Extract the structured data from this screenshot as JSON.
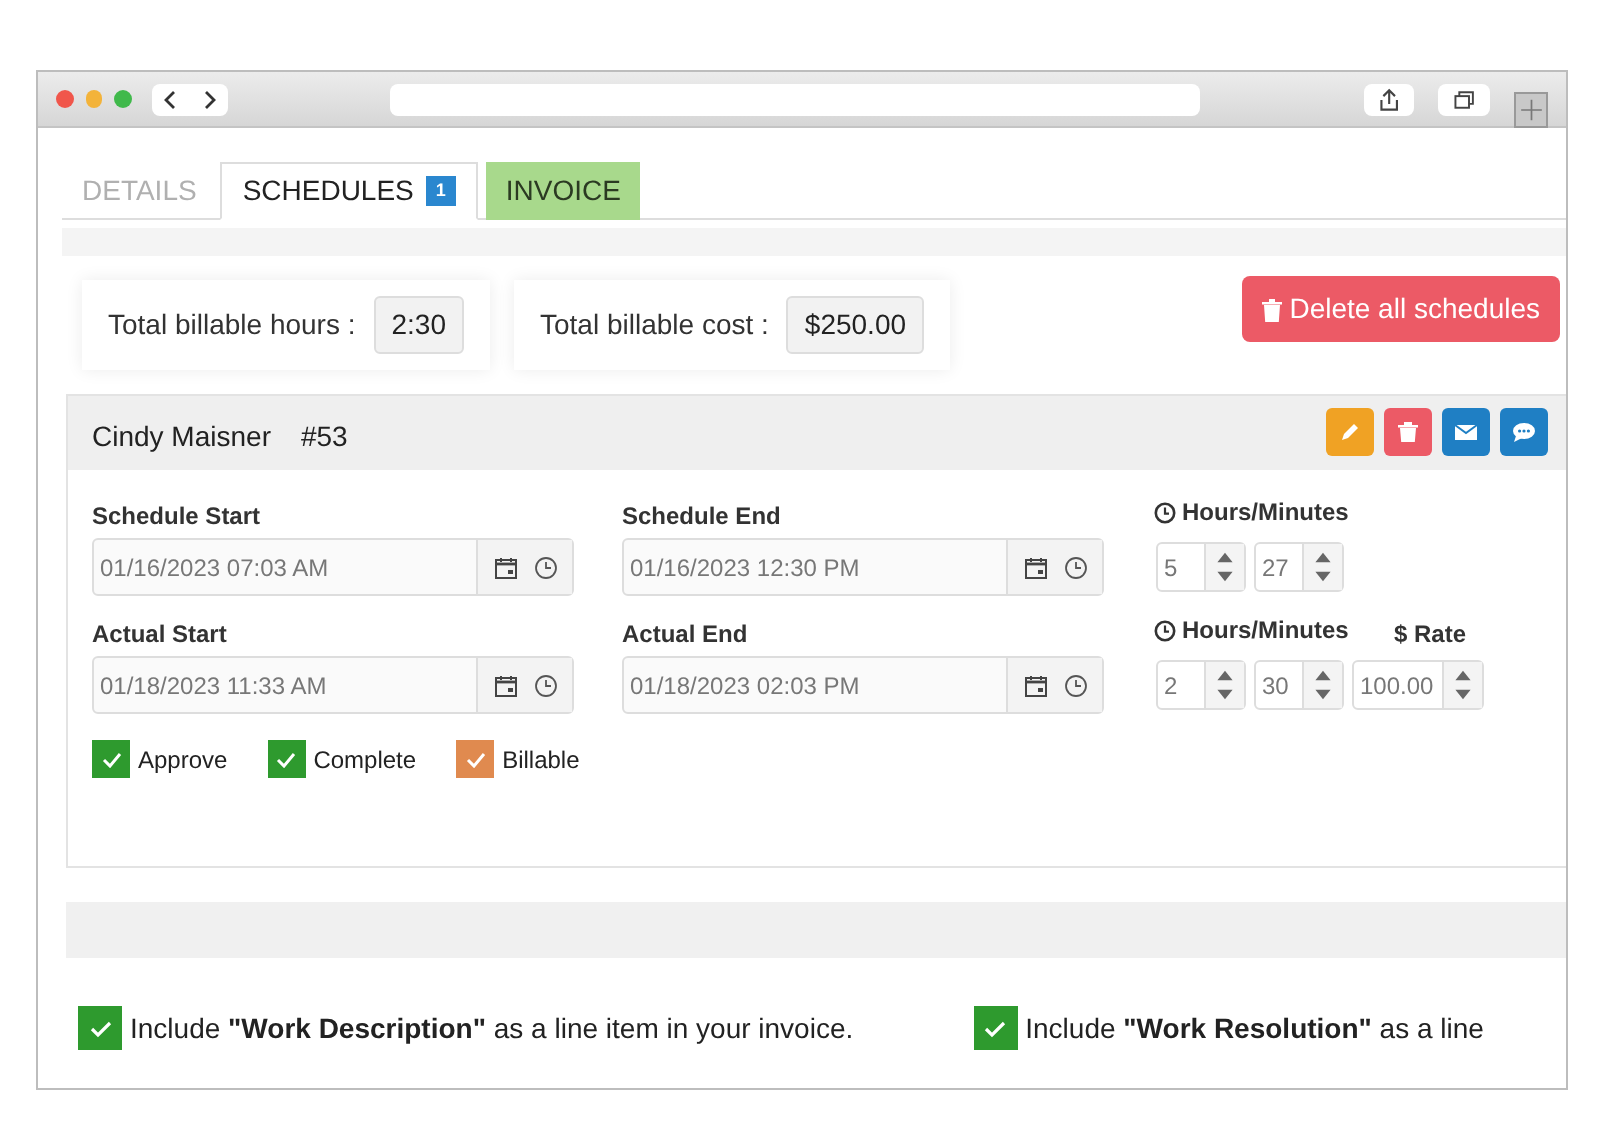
{
  "tabs": [
    {
      "label": "DETAILS",
      "selected": false,
      "kind": "plain"
    },
    {
      "label": "SCHEDULES",
      "selected": true,
      "kind": "plain",
      "badge": "1"
    },
    {
      "label": "INVOICE",
      "selected": false,
      "kind": "highlight"
    }
  ],
  "totals": [
    {
      "label": "Total billable hours :",
      "value": "2:30"
    },
    {
      "label": "Total billable cost :",
      "value": "$250.00"
    }
  ],
  "delete_all_button": {
    "label": "Delete all schedules"
  },
  "schedule": {
    "name": "Cindy Maisner",
    "number": "#53",
    "actions": [
      {
        "kind": "edit"
      },
      {
        "kind": "delete"
      },
      {
        "kind": "email"
      },
      {
        "kind": "comment"
      }
    ],
    "rows": [
      {
        "start_label": "Schedule Start",
        "start_value": "01/16/2023 07:03 AM",
        "end_label": "Schedule End",
        "end_value": "01/16/2023 12:30 PM",
        "duration_label": "Hours/Minutes",
        "hours": "5",
        "minutes": "27"
      },
      {
        "start_label": "Actual Start",
        "start_value": "01/18/2023 11:33 AM",
        "end_label": "Actual End",
        "end_value": "01/18/2023 02:03 PM",
        "duration_label": "Hours/Minutes",
        "hours": "2",
        "minutes": "30",
        "rate_label": "$ Rate",
        "rate": "100.00"
      }
    ],
    "checks": [
      {
        "label": "Approve",
        "checked": true,
        "color": "#2e9a2e"
      },
      {
        "label": "Complete",
        "checked": true,
        "color": "#2e9a2e"
      },
      {
        "label": "Billable",
        "checked": true,
        "color": "#e08a4f"
      }
    ]
  },
  "invoice_options": [
    {
      "text": "Include **\"Work Description\"** as a line item in your invoice.",
      "checked": true
    },
    {
      "text": "Include **\"Work Resolution\"** as a line",
      "checked": true
    }
  ]
}
